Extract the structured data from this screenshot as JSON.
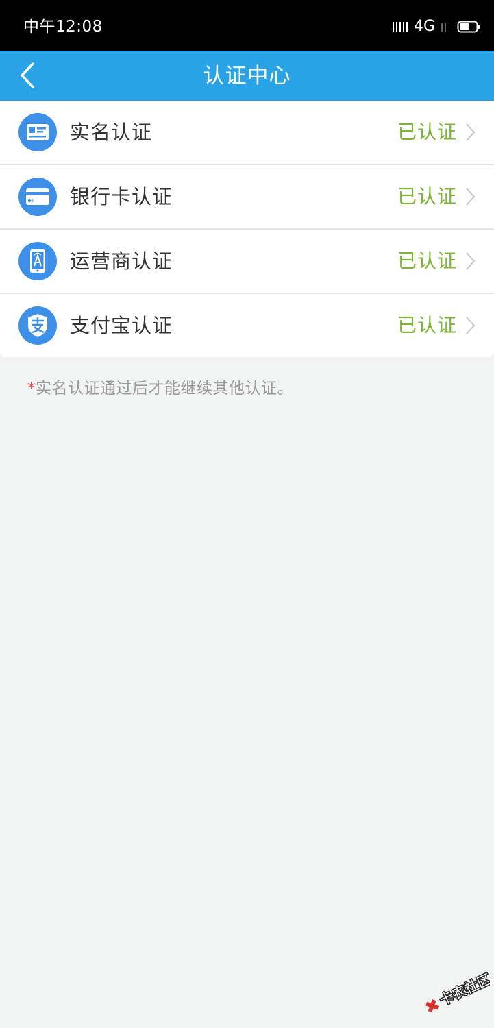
{
  "status_bar": {
    "time": "中午12:08",
    "network": "4G"
  },
  "nav": {
    "title": "认证中心",
    "back_icon": "chevron-left-icon"
  },
  "items": [
    {
      "label": "实名认证",
      "status": "已认证",
      "icon": "id-card-icon"
    },
    {
      "label": "银行卡认证",
      "status": "已认证",
      "icon": "bank-card-icon"
    },
    {
      "label": "运营商认证",
      "status": "已认证",
      "icon": "mobile-carrier-icon"
    },
    {
      "label": "支付宝认证",
      "status": "已认证",
      "icon": "alipay-icon"
    }
  ],
  "note": {
    "star": "*",
    "text": "实名认证通过后才能继续其他认证。"
  },
  "watermark": {
    "text": "卡农社区"
  },
  "colors": {
    "status_bar_bg": "#000000",
    "nav_bg": "#2aa3e6",
    "page_bg": "#f2f3f3",
    "icon_blue": "#3d8fe7",
    "status_green": "#7cb632",
    "note_star": "#e64545",
    "note_text": "#9a9a9a"
  }
}
